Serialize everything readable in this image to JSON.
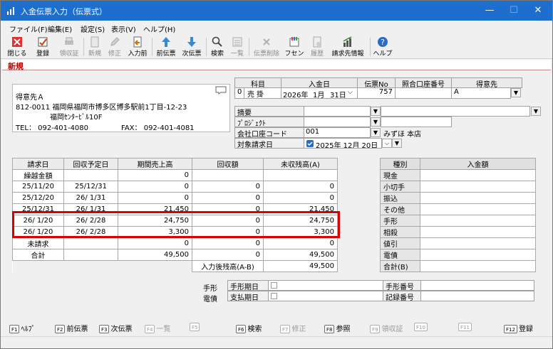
{
  "window": {
    "title": "入金伝票入力（伝票式）",
    "minimize": "—",
    "maximize": "☐",
    "close": "✕"
  },
  "menu": [
    "ファイル(F)",
    "編集(E)",
    "設定(S)",
    "表示(V)",
    "ヘルプ(H)"
  ],
  "toolbar": {
    "close": "閉じる",
    "register": "登録",
    "receipt": "領収証",
    "new": "新規",
    "edit": "修正",
    "input_prev": "入力前",
    "prev_slip": "前伝票",
    "next_slip": "次伝票",
    "search": "検索",
    "list": "一覧",
    "delete_slip": "伝票削除",
    "fusen": "フセン",
    "history": "履歴",
    "billing_info": "請求先情報",
    "help": "ヘルプ"
  },
  "mode": "新規",
  "customer": {
    "name": "得意先Ａ",
    "address1": "812-0011 福岡県福岡市博多区博多駅前1丁目-12-23",
    "address2": "福岡ｾﾝﾀｰﾋﾞﾙ10F",
    "tel": "TEL： 092-401-4080",
    "fax": "FAX： 092-401-4081"
  },
  "header": {
    "col_subject": "科目",
    "col_date": "入金日",
    "col_slip": "伝票No",
    "col_account": "照合口座番号",
    "col_customer": "得意先",
    "subject_code": "0",
    "subject_name": "売 掛",
    "year": "2026年",
    "month": "1月",
    "day": "31日",
    "slip_no": "757",
    "account_no": "",
    "customer_code": "A"
  },
  "form": {
    "summary_label": "摘要",
    "summary_value": "",
    "project_label": "ﾌﾟﾛｼﾞｪｸﾄ",
    "project_value": "",
    "bank_label": "会社口座コード",
    "bank_code": "001",
    "bank_name": "みずほ 本店",
    "target_label": "対象請求日",
    "target_date": "2025年 12月 20日"
  },
  "ar_table": {
    "headers": [
      "請求日",
      "回収予定日",
      "期間売上高",
      "回収額",
      "未収残高(A)"
    ],
    "rows": [
      [
        "繰越金額",
        "",
        "0",
        "",
        ""
      ],
      [
        "25/11/20",
        "25/12/31",
        "0",
        "0",
        "0"
      ],
      [
        "25/12/20",
        "26/ 1/31",
        "0",
        "0",
        "0"
      ],
      [
        "25/12/31",
        "26/ 1/31",
        "21,450",
        "0",
        "21,450"
      ],
      [
        "26/ 1/20",
        "26/ 2/28",
        "24,750",
        "0",
        "24,750"
      ],
      [
        "26/ 1/20",
        "26/ 2/28",
        "3,300",
        "0",
        "3,300"
      ],
      [
        "未請求",
        "",
        "0",
        "0",
        "0"
      ],
      [
        "合計",
        "",
        "49,500",
        "0",
        "49,500"
      ]
    ],
    "after_label": "入力後残高(A-B)",
    "after_value": "49,500"
  },
  "payment": {
    "header_type": "種別",
    "header_amount": "入金額",
    "rows": [
      "現金",
      "小切手",
      "振込",
      "その他",
      "手形",
      "相殺",
      "値引",
      "電債",
      "合計(B)"
    ]
  },
  "bills": {
    "tegata_label": "手形",
    "tegata_due": "手形期日",
    "densai_label": "電債",
    "densai_due": "支払期日",
    "tegata_no": "手形番号",
    "record_no": "記録番号"
  },
  "fkeys": [
    {
      "cap": "F1",
      "label": "ﾍﾙﾌﾟ",
      "enabled": true
    },
    {
      "cap": "F2",
      "label": "前伝票",
      "enabled": true
    },
    {
      "cap": "F3",
      "label": "次伝票",
      "enabled": true
    },
    {
      "cap": "F4",
      "label": "一覧",
      "enabled": false
    },
    {
      "cap": "F5",
      "label": "",
      "enabled": false
    },
    {
      "cap": "F6",
      "label": "検索",
      "enabled": true
    },
    {
      "cap": "F7",
      "label": "修正",
      "enabled": false
    },
    {
      "cap": "F8",
      "label": "参照",
      "enabled": true
    },
    {
      "cap": "F9",
      "label": "領収証",
      "enabled": false
    },
    {
      "cap": "F10",
      "label": "",
      "enabled": false
    },
    {
      "cap": "F11",
      "label": "",
      "enabled": false
    },
    {
      "cap": "F12",
      "label": "登録",
      "enabled": true
    }
  ],
  "colors": {
    "titlebar": "#1d6ecd",
    "mode": "#c00000",
    "highlight": "#d80000"
  }
}
